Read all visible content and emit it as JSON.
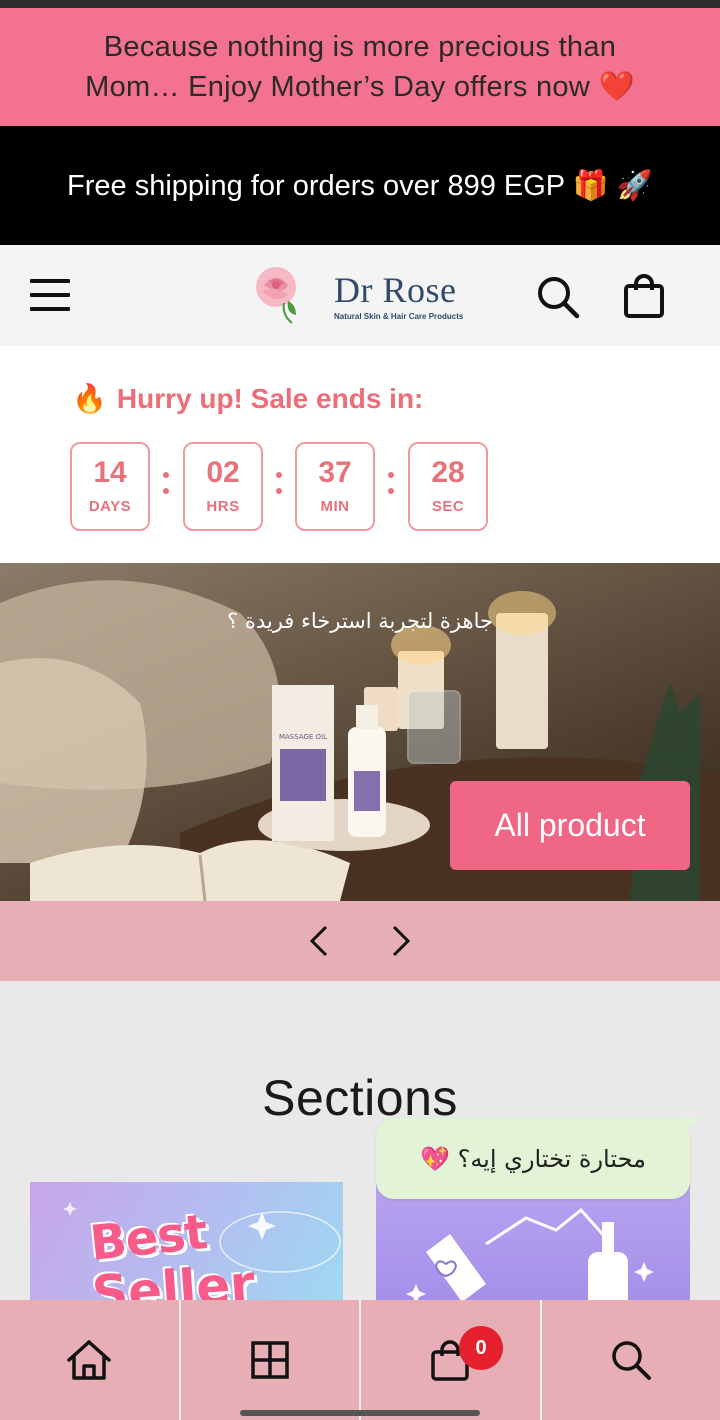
{
  "announcement_pink": {
    "text": "Because nothing is more precious than Mom… Enjoy Mother’s Day offers now",
    "emoji": "❤️"
  },
  "announcement_black": {
    "text": "Free shipping for orders over 899 EGP 🎁 🚀"
  },
  "header": {
    "brand_name": "Dr Rose",
    "brand_tagline": "Natural Skin & Hair Care Products",
    "icons": [
      "menu-icon",
      "rose-logo",
      "search-icon",
      "bag-icon"
    ]
  },
  "countdown": {
    "emoji": "🔥",
    "label": "Hurry up! Sale ends in:",
    "days": "14",
    "days_unit": "DAYS",
    "hours": "02",
    "hours_unit": "HRS",
    "minutes": "37",
    "minutes_unit": "MIN",
    "seconds": "28",
    "seconds_unit": "SEC"
  },
  "hero": {
    "caption": "جاهزة لتجربة استرخاء فريدة ؟",
    "button_label": "All product",
    "product_label": "MASSAGE OIL"
  },
  "slider": {
    "icons": [
      "chevron-left-icon",
      "chevron-right-icon"
    ]
  },
  "sections": {
    "title": "Sections",
    "cards": [
      {
        "label_line1": "Best",
        "label_line2": "Seller"
      },
      {
        "label": ""
      }
    ]
  },
  "chat": {
    "text": "محتارة تختاري إيه؟ 💖"
  },
  "bottom_nav": {
    "cart_count": "0",
    "icons": [
      "home-icon",
      "grid-icon",
      "cart-icon",
      "search-icon"
    ]
  },
  "colors": {
    "pink_banner": "#f2728f",
    "accent_pink": "#f06786",
    "countdown_red": "#e8727a",
    "nav_pink": "#e7aeb6",
    "brand_blue": "#2f4a6a",
    "badge_red": "#e4202e"
  }
}
